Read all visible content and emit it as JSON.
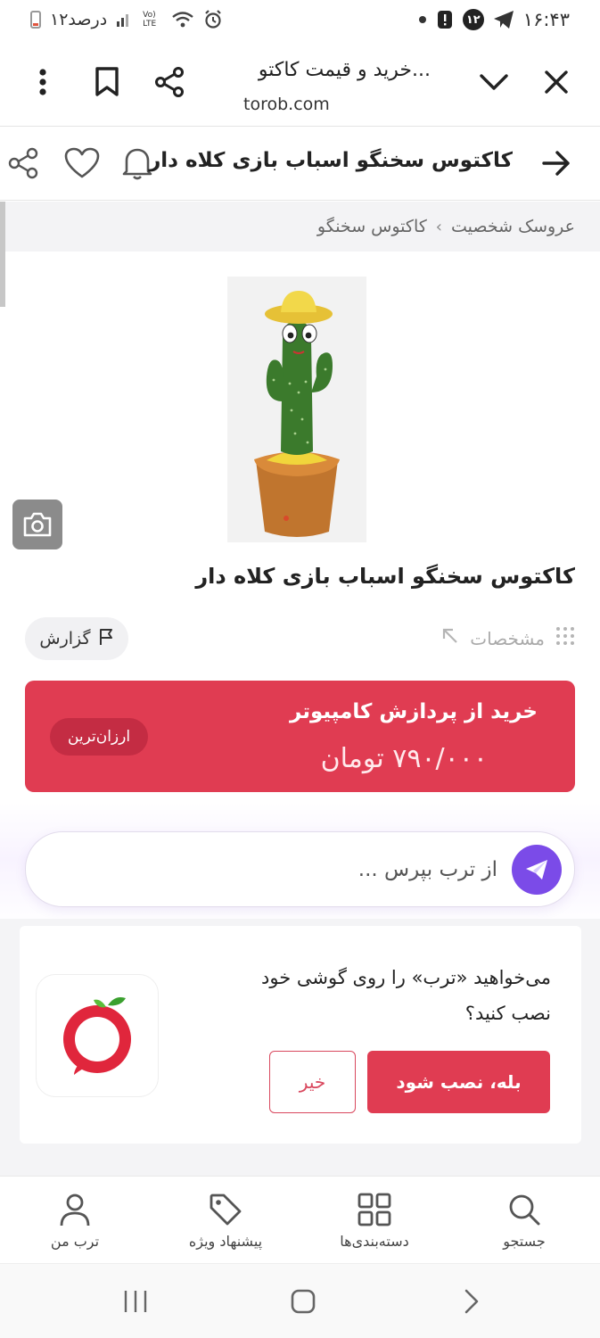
{
  "status_bar": {
    "time": "۱۶:۴۳",
    "notification_count": "۱۲",
    "battery_text": "۱۲درصد",
    "network_label": "Vo) LTE"
  },
  "browser": {
    "page_title": "خرید و قیمت کاکتو...",
    "url": "torob.com"
  },
  "header": {
    "title": "کاکتوس سخنگو اسباب بازی کلاه دار"
  },
  "breadcrumb": {
    "items": [
      "عروسک شخصیت",
      "کاکتوس سخنگو"
    ],
    "separator": "›"
  },
  "product": {
    "title": "کاکتوس سخنگو اسباب بازی کلاه دار",
    "specs_label": "مشخصات",
    "report_label": "گزارش"
  },
  "offer": {
    "store": "خرید از پردازش کامپیوتر",
    "price": "۷۹۰/۰۰۰ تومان",
    "badge": "ارزان‌ترین"
  },
  "ask": {
    "placeholder": "از ترب بپرس ..."
  },
  "install_prompt": {
    "message": "می‌خواهید «ترب» را روی گوشی خود نصب کنید؟",
    "yes_label": "بله، نصب شود",
    "no_label": "خیر"
  },
  "bottom_nav": {
    "items": [
      {
        "label": "جستجو",
        "icon": "search-icon"
      },
      {
        "label": "دسته‌بندی‌ها",
        "icon": "grid-icon"
      },
      {
        "label": "پیشنهاد ویژه",
        "icon": "tag-icon"
      },
      {
        "label": "ترب من",
        "icon": "user-icon"
      }
    ]
  },
  "colors": {
    "brand_red": "#e03c52",
    "ask_purple": "#7b4be8"
  }
}
